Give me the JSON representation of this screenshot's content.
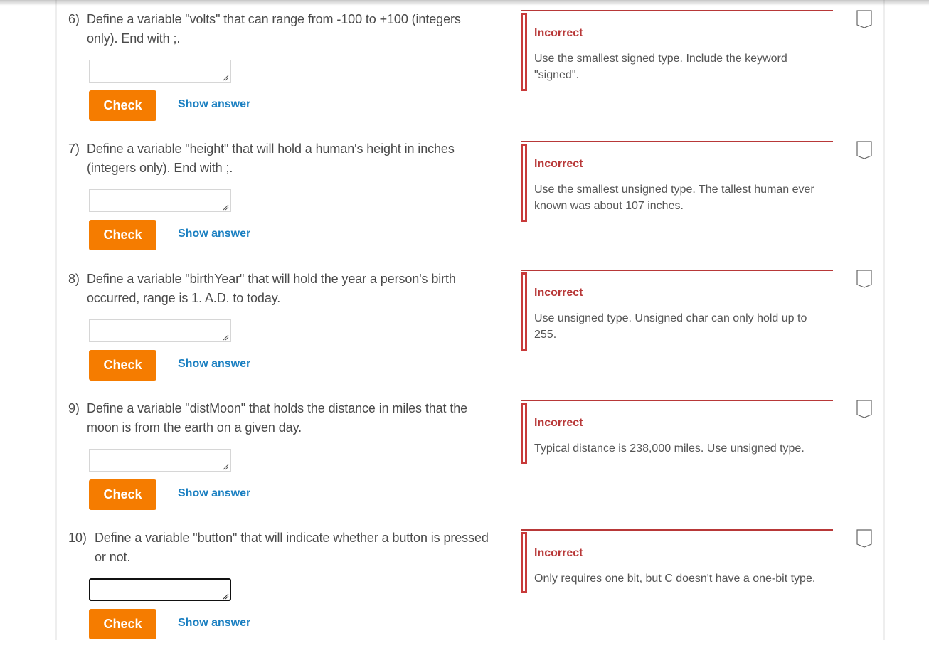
{
  "colors": {
    "check_button": "#f57c00",
    "show_answer_link": "#1a7fc1",
    "incorrect_red": "#b83838",
    "text": "#4a4a4a"
  },
  "questions": [
    {
      "number": "6)",
      "prompt": "Define a variable \"volts\" that can range from -100 to +100 (integers only). End with ;.",
      "input_value": "",
      "check_label": "Check",
      "show_answer_label": "Show answer",
      "feedback_status": "Incorrect",
      "feedback_text": "Use the smallest signed type. Include the keyword \"signed\".",
      "bookmark_icon": "bookmark-outline-icon",
      "focused": false
    },
    {
      "number": "7)",
      "prompt": "Define a variable \"height\" that will hold a human's height in inches (integers only). End with ;.",
      "input_value": "",
      "check_label": "Check",
      "show_answer_label": "Show answer",
      "feedback_status": "Incorrect",
      "feedback_text": "Use the smallest unsigned type. The tallest human ever known was about 107 inches.",
      "bookmark_icon": "bookmark-outline-icon",
      "focused": false
    },
    {
      "number": "8)",
      "prompt": "Define a variable \"birthYear\" that will hold the year a person's birth occurred, range is 1. A.D. to today.",
      "input_value": "",
      "check_label": "Check",
      "show_answer_label": "Show answer",
      "feedback_status": "Incorrect",
      "feedback_text": "Use unsigned type. Unsigned char can only hold up to 255.",
      "bookmark_icon": "bookmark-outline-icon",
      "focused": false
    },
    {
      "number": "9)",
      "prompt": "Define a variable \"distMoon\" that holds the distance in miles that the moon is from the earth on a given day.",
      "input_value": "",
      "check_label": "Check",
      "show_answer_label": "Show answer",
      "feedback_status": "Incorrect",
      "feedback_text": "Typical distance is 238,000 miles. Use unsigned type.",
      "bookmark_icon": "bookmark-outline-icon",
      "focused": false
    },
    {
      "number": "10)",
      "prompt": "Define a variable \"button\" that will indicate whether a button is pressed or not.",
      "input_value": "",
      "check_label": "Check",
      "show_answer_label": "Show answer",
      "feedback_status": "Incorrect",
      "feedback_text": "Only requires one bit, but C doesn't have a one-bit type.",
      "bookmark_icon": "bookmark-outline-icon",
      "focused": true
    }
  ]
}
